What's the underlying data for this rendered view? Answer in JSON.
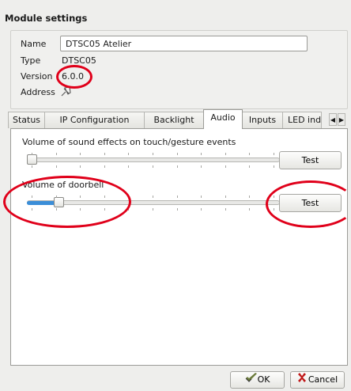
{
  "title": "Module settings",
  "info": {
    "name_label": "Name",
    "name_value": "DTSC05 Atelier",
    "type_label": "Type",
    "type_value": "DTSC05",
    "version_label": "Version",
    "version_value": "6.0.0",
    "address_label": "Address"
  },
  "tabs": [
    {
      "label": "Status"
    },
    {
      "label": "IP Configuration"
    },
    {
      "label": "Backlight"
    },
    {
      "label": "Audio"
    },
    {
      "label": "Inputs"
    },
    {
      "label": "LED ind"
    }
  ],
  "active_tab": "Audio",
  "audio": {
    "sfx_label": "Volume of sound effects on touch/gesture events",
    "sfx_level": 0,
    "doorbell_label": "Volume of doorbell",
    "doorbell_level": 0.11,
    "test_label": "Test"
  },
  "footer": {
    "ok_label": "OK",
    "cancel_label": "Cancel"
  },
  "annotation_color": "#e0001a",
  "icons": [
    "pin-icon",
    "tab-scroll-left-icon",
    "tab-scroll-right-icon",
    "ok-icon",
    "cancel-icon"
  ]
}
